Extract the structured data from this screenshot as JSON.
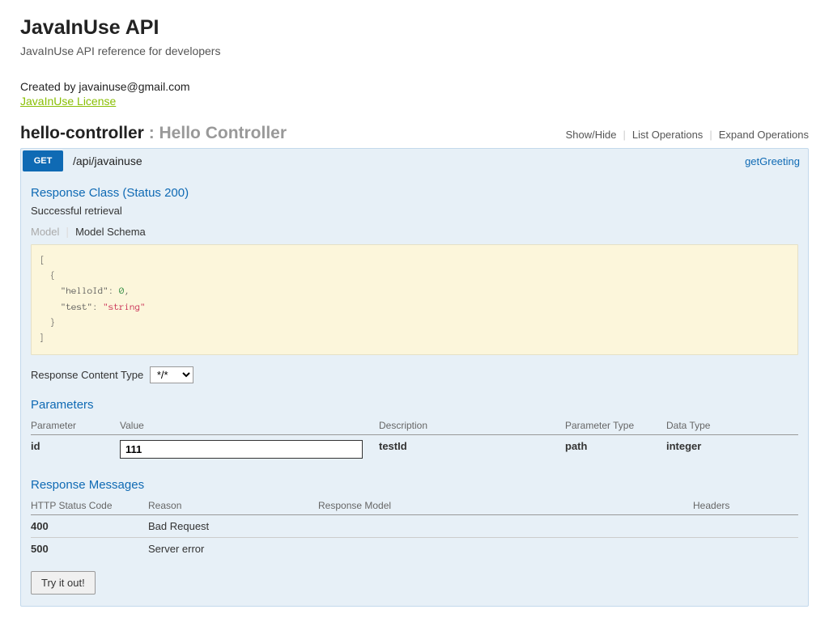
{
  "header": {
    "title": "JavaInUse API",
    "description": "JavaInUse API reference for developers",
    "created_by": "Created by javainuse@gmail.com",
    "license_text": "JavaInUse License"
  },
  "controller": {
    "name": "hello-controller",
    "suffix": " : Hello Controller"
  },
  "ops_links": {
    "show_hide": "Show/Hide",
    "list": "List Operations",
    "expand": "Expand Operations"
  },
  "endpoint": {
    "method": "GET",
    "path": "/api/javainuse",
    "nickname": "getGreeting",
    "response_class_title": "Response Class (Status 200)",
    "op_desc": "Successful retrieval",
    "tabs": {
      "model": "Model",
      "schema": "Model Schema"
    },
    "schema_lines": {
      "l0": "[",
      "l1": "  {",
      "l2a": "    \"helloId\"",
      "l2b": ": ",
      "l2c": "0",
      "l2d": ",",
      "l3a": "    \"test\"",
      "l3b": ": ",
      "l3c": "\"string\"",
      "l4": "  }",
      "l5": "]"
    },
    "rct_label": "Response Content Type",
    "rct_value": "*/*",
    "parameters_title": "Parameters",
    "param_headers": {
      "parameter": "Parameter",
      "value": "Value",
      "description": "Description",
      "ptype": "Parameter Type",
      "dtype": "Data Type"
    },
    "param_row": {
      "name": "id",
      "value": "111",
      "description": "testId",
      "ptype": "path",
      "dtype": "integer"
    },
    "responses_title": "Response Messages",
    "resp_headers": {
      "status": "HTTP Status Code",
      "reason": "Reason",
      "model": "Response Model",
      "headers": "Headers"
    },
    "resp_rows": {
      "r0": {
        "code": "400",
        "reason": "Bad Request"
      },
      "r1": {
        "code": "500",
        "reason": "Server error"
      }
    },
    "try_label": "Try it out!"
  }
}
